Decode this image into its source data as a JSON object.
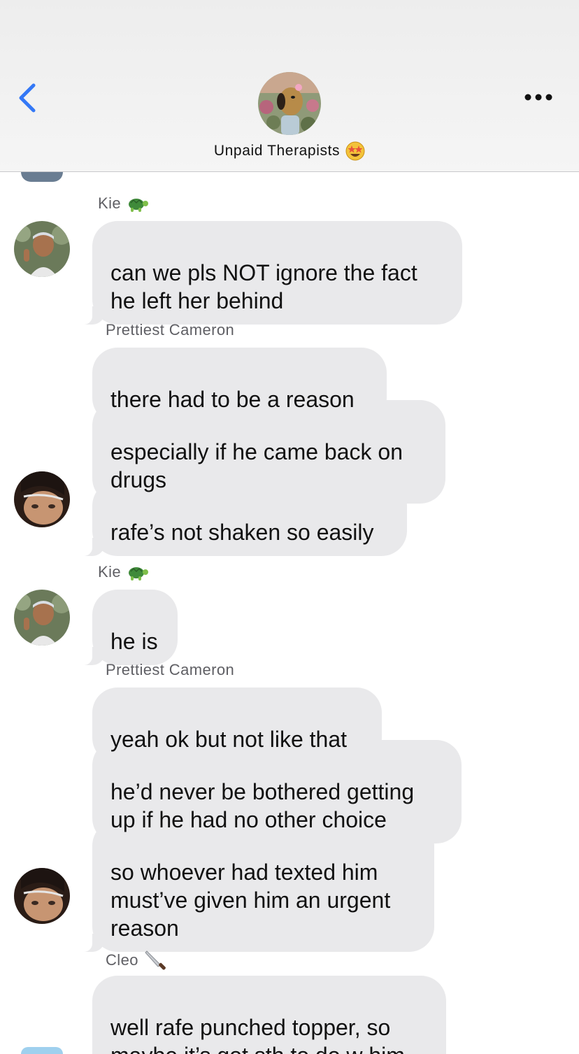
{
  "header": {
    "group_name": "Unpaid Therapists",
    "group_emoji": "star-struck-emoji",
    "back_icon": "chevron-left-icon",
    "more_icon": "ellipsis-icon",
    "accent_color": "#3478f6"
  },
  "colors": {
    "bubble": "#e9e9eb",
    "sender": "#5f5f64",
    "text": "#111111"
  },
  "messages": [
    {
      "sender": "Kie",
      "sender_icon": "turtle-emoji",
      "texts": [
        "can we pls NOT ignore the fact\nhe left her behind"
      ]
    },
    {
      "sender": "Prettiest Cameron",
      "texts": [
        "there had to be a reason",
        "especially if he came back on\ndrugs",
        "rafe’s not shaken so easily"
      ]
    },
    {
      "sender": "Kie",
      "sender_icon": "turtle-emoji",
      "texts": [
        "he is"
      ]
    },
    {
      "sender": "Prettiest Cameron",
      "texts": [
        "yeah ok but not like that",
        "he’d never be bothered getting\nup if he had no other choice",
        "so whoever had texted him\nmust’ve given him an urgent\nreason"
      ]
    },
    {
      "sender": "Cleo",
      "sender_icon": "knife-emoji",
      "texts": [
        "well rafe punched topper, so\nmaybe it’s got sth to do w him"
      ]
    }
  ]
}
